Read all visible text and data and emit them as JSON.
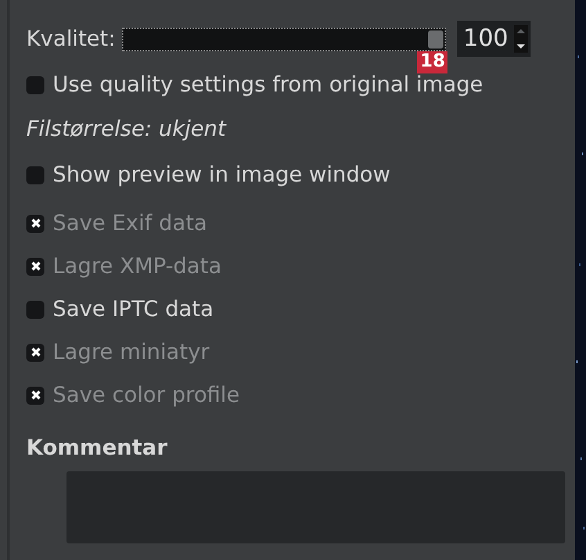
{
  "quality": {
    "label": "Kvalitet:",
    "level": 1.0,
    "value": "100",
    "badge": "18"
  },
  "use_original": {
    "label": "Use quality settings from original image",
    "checked": false,
    "disabled": false
  },
  "file_size": "Filstørrelse: ukjent",
  "options": [
    {
      "label": "Show preview in image window",
      "checked": false,
      "disabled": false
    },
    {
      "label": "Save Exif data",
      "checked": true,
      "disabled": true
    },
    {
      "label": "Lagre XMP-data",
      "checked": true,
      "disabled": true
    },
    {
      "label": "Save IPTC data",
      "checked": false,
      "disabled": false
    },
    {
      "label": "Lagre miniatyr",
      "checked": true,
      "disabled": true
    },
    {
      "label": "Save color profile",
      "checked": true,
      "disabled": true
    }
  ],
  "comment": {
    "label": "Kommentar"
  }
}
